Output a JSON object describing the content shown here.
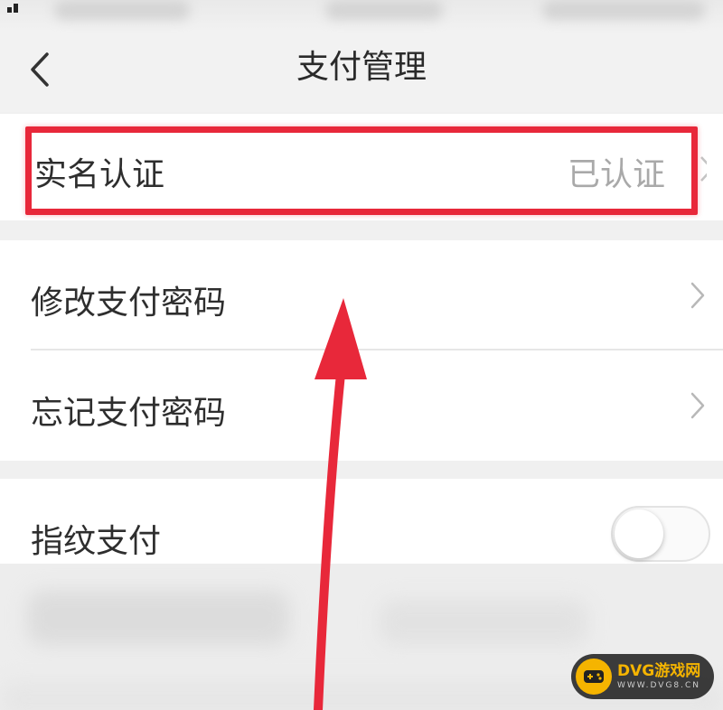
{
  "header": {
    "title": "支付管理",
    "back_icon": "chevron-left-icon"
  },
  "settings": {
    "real_name": {
      "label": "实名认证",
      "status": "已认证"
    },
    "change_password": {
      "label": "修改支付密码",
      "icon": "chevron-right-icon"
    },
    "forgot_password": {
      "label": "忘记支付密码",
      "icon": "chevron-right-icon"
    },
    "fingerprint_pay": {
      "label": "指纹支付",
      "enabled": false
    }
  },
  "annotation": {
    "highlight_color": "#e8283a",
    "arrow_color": "#e8283a",
    "highlighted_item": "实名认证"
  },
  "watermark": {
    "name": "DVG游戏网",
    "domain": "WWW.DVG8.CN",
    "accent_color": "#f5b400"
  }
}
